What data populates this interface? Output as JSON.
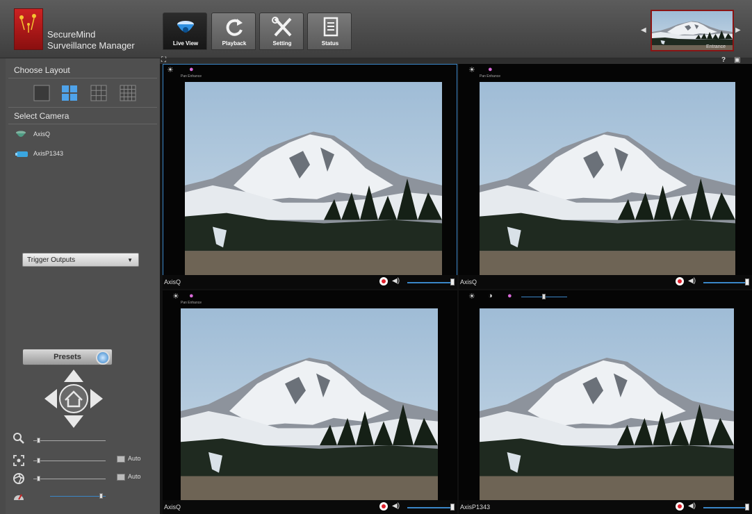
{
  "app": {
    "brand_name": "SecureMind",
    "brand_subtitle": "Surveillance Manager"
  },
  "tabs": [
    {
      "label": "Live View",
      "icon": "dome-camera-icon",
      "active": true
    },
    {
      "label": "Playback",
      "icon": "replay-icon",
      "active": false
    },
    {
      "label": "Setting",
      "icon": "tools-icon",
      "active": false
    },
    {
      "label": "Status",
      "icon": "document-icon",
      "active": false
    }
  ],
  "preview": {
    "label": "Entrance"
  },
  "sidebar": {
    "layout_heading": "Choose Layout",
    "layouts": [
      "1x1",
      "2x2",
      "3x3",
      "4x4"
    ],
    "selected_layout": "2x2",
    "camera_heading": "Select Camera",
    "cameras": [
      {
        "name": "AxisQ",
        "icon": "dome-camera-icon"
      },
      {
        "name": "AxisP1343",
        "icon": "bullet-camera-icon"
      }
    ],
    "trigger_select": "Trigger Outputs",
    "presets_label": "Presets",
    "zoom_level": 0.05,
    "focus_level": 0.05,
    "iris_level": 0.05,
    "speed_level": 0.95,
    "auto_label": "Auto"
  },
  "panes": [
    {
      "name": "AxisQ",
      "tag": "Pan Enhance",
      "selected": true,
      "volume": 1.0
    },
    {
      "name": "AxisQ",
      "tag": "Pan Enhance",
      "selected": false,
      "volume": 1.0
    },
    {
      "name": "AxisQ",
      "tag": "Pan Enhance",
      "selected": false,
      "volume": 1.0
    },
    {
      "name": "AxisP1343",
      "tag": "",
      "selected": false,
      "volume": 1.0
    }
  ],
  "colors": {
    "accent": "#3a86c8",
    "record": "#e0202c",
    "brand_red": "#c22222"
  }
}
